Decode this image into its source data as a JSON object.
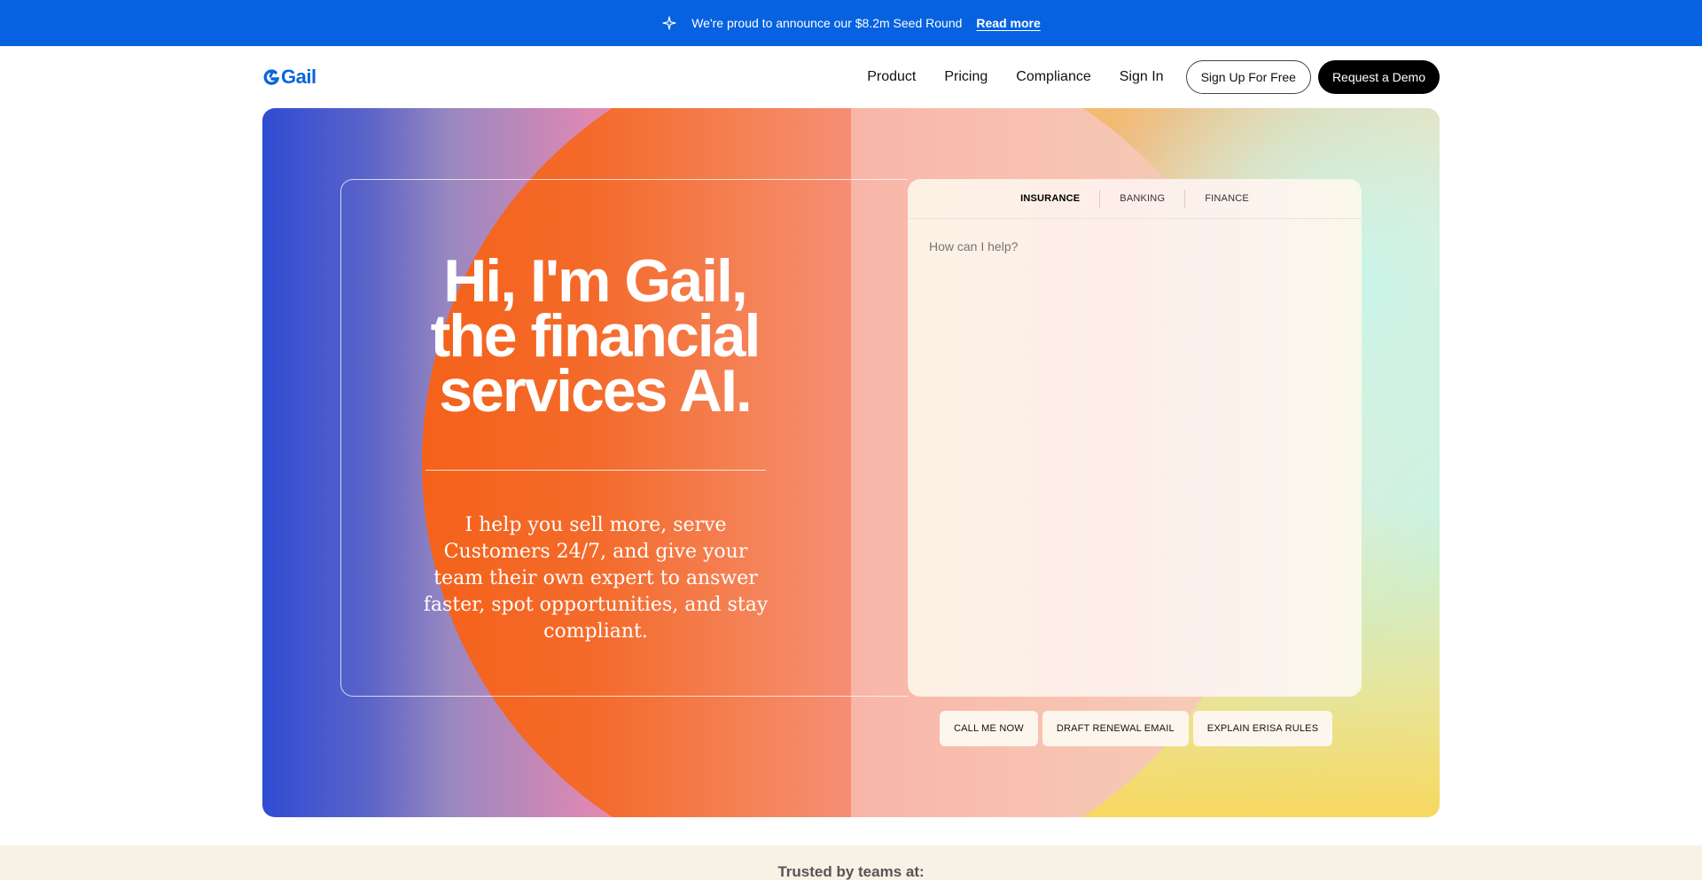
{
  "announcement": {
    "text": "We're proud to announce our $8.2m Seed Round",
    "link": "Read more",
    "icon": "sparkle-icon"
  },
  "nav": {
    "logo": "Gail",
    "items": [
      {
        "label": "Product"
      },
      {
        "label": "Pricing"
      },
      {
        "label": "Compliance"
      },
      {
        "label": "Sign In"
      }
    ],
    "signup_label": "Sign Up For Free",
    "demo_label": "Request a Demo"
  },
  "hero": {
    "headline_line1": "Hi, I'm Gail,",
    "headline_line2": "the financial",
    "headline_line3": "services AI.",
    "subtext": "I help you sell more, serve Customers 24/7, and give your team their own expert to answer faster, spot opportunities, and stay compliant."
  },
  "chat": {
    "tabs": [
      {
        "label": "INSURANCE",
        "active": true
      },
      {
        "label": "BANKING",
        "active": false
      },
      {
        "label": "FINANCE",
        "active": false
      }
    ],
    "placeholder": "How can I help?",
    "suggestions": [
      {
        "label": "CALL ME NOW"
      },
      {
        "label": "DRAFT RENEWAL EMAIL"
      },
      {
        "label": "EXPLAIN ERISA RULES"
      }
    ]
  },
  "trusted": {
    "label": "Trusted by teams at:"
  },
  "colors": {
    "announce_bg": "#0662e0",
    "brand_blue": "#0a66d8",
    "dark_button": "#000000",
    "trusted_bg": "#f8f1e6"
  }
}
